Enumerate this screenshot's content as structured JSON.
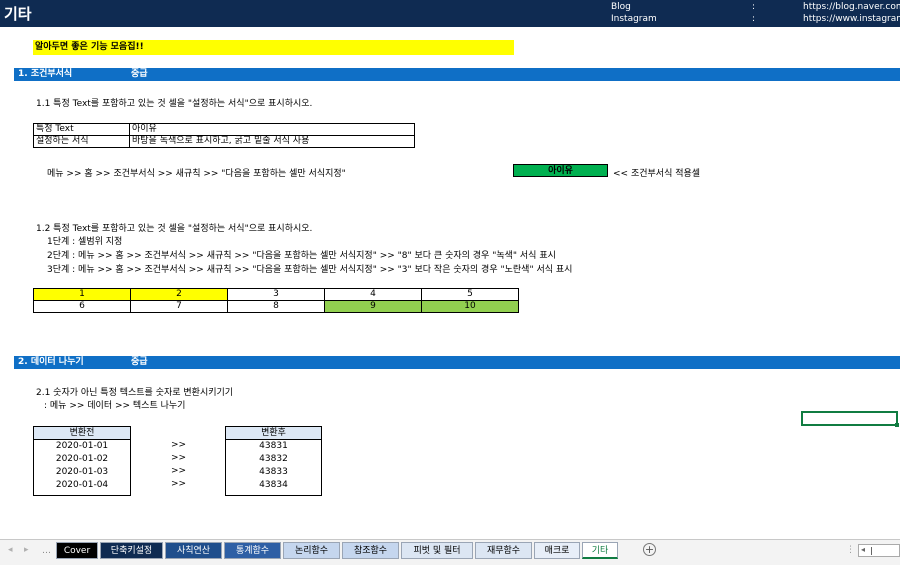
{
  "header": {
    "title": "기타",
    "blog_label": "Blog",
    "instagram_label": "Instagram",
    "colon": ":",
    "blog_url": "https://blog.naver.com",
    "instagram_url": "https://www.instagram"
  },
  "banner": "알아두면 좋은 기능 모음집!!",
  "section1": {
    "title": "1. 조건부서식",
    "level": "중급",
    "q1": {
      "title": "1.1 특정 Text를 포함하고 있는 것 셀을 \"설정하는 서식\"으로 표시하시오.",
      "rows": [
        {
          "label": "특정 Text",
          "value": "아이유"
        },
        {
          "label": "설정하는 서식",
          "value": "바탕을 녹색으로 표시하고, 굵고 밑줄 서식 사용"
        }
      ],
      "menu": "메뉴 >> 홈 >> 조건부서식 >> 새규칙 >> \"다음을 포함하는 셀만 서식지정\"",
      "result": "아이유",
      "result_note": "<< 조건부서식 적용셀"
    },
    "q2": {
      "title": "1.2 특정 Text를 포함하고 있는 것 셀을 \"설정하는 서식\"으로 표시하시오.",
      "step1": "1단계 : 셀범위 지정",
      "step2": "2단계 : 메뉴 >> 홈 >> 조건부서식 >> 새규칙 >> \"다음을 포함하는 셀만 서식지정\" >> \"8\" 보다 큰 숫자의 경우 \"녹색\" 서식 표시",
      "step3": "3단계 : 메뉴 >> 홈 >> 조건부서식 >> 새규칙 >> \"다음을 포함하는 셀만 서식지정\" >> \"3\" 보다 작은 숫자의 경우 \"노란색\" 서식 표시",
      "row1": [
        "1",
        "2",
        "3",
        "4",
        "5"
      ],
      "row2": [
        "6",
        "7",
        "8",
        "9",
        "10"
      ],
      "color_yellow": "#ffff00",
      "color_green": "#92d050"
    }
  },
  "section2": {
    "title": "2. 데이터 나누기",
    "level": "중급",
    "q1": {
      "title": "2.1 숫자가 아닌 특정 텍스트를 숫자로 변환시키기기",
      "menu": ": 메뉴 >> 데이터 >> 텍스트 나누기",
      "before_header": "변환전",
      "after_header": "변환후",
      "arrow": ">>",
      "before": [
        "2020-01-01",
        "2020-01-02",
        "2020-01-03",
        "2020-01-04"
      ],
      "after": [
        "43831",
        "43832",
        "43833",
        "43834"
      ]
    }
  },
  "sheet_tabs": [
    {
      "label": "Cover"
    },
    {
      "label": "단축키설정"
    },
    {
      "label": "사칙연산"
    },
    {
      "label": "통계함수"
    },
    {
      "label": "논리함수"
    },
    {
      "label": "참조함수"
    },
    {
      "label": "피벗 및 필터"
    },
    {
      "label": "재무함수"
    },
    {
      "label": "매크로"
    },
    {
      "label": "기타"
    }
  ],
  "add_sheet_icon": "plus-circle-icon"
}
